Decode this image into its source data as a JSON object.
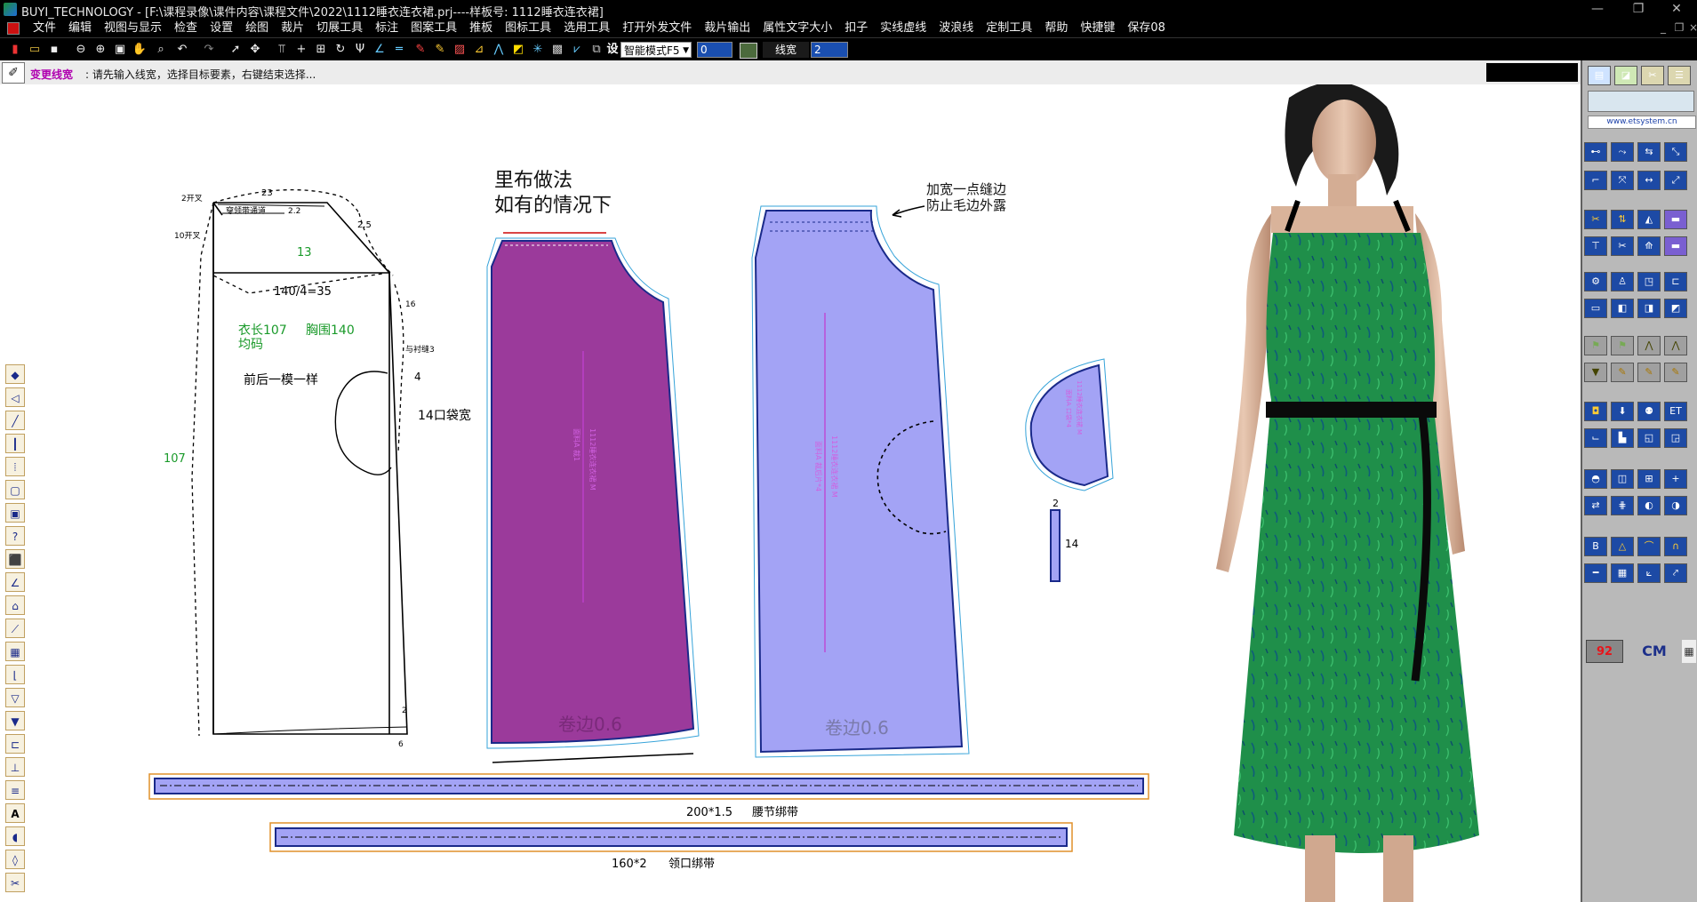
{
  "window": {
    "title": "BUYI_TECHNOLOGY - [F:\\课程录像\\课件内容\\课程文件\\2022\\1112睡衣连衣裙.prj----样板号: 1112睡衣连衣裙]"
  },
  "menu": {
    "items": [
      "文件",
      "编辑",
      "视图与显示",
      "检查",
      "设置",
      "绘图",
      "裁片",
      "切展工具",
      "标注",
      "图案工具",
      "推板",
      "图标工具",
      "选用工具",
      "打开外发文件",
      "裁片输出",
      "属性文字大小",
      "扣子",
      "实线虚线",
      "波浪线",
      "定制工具",
      "帮助",
      "快捷键",
      "保存08"
    ]
  },
  "toolbar": {
    "mode_label": "智能模式F5",
    "value_field": "0",
    "line_width_label": "线宽",
    "line_width_value": "2"
  },
  "status": {
    "command": "变更线宽",
    "prompt": ": 请先输入线宽，选择目标要素，右键结束选择..."
  },
  "pattern": {
    "left_top_2": "2开叉",
    "left_top_10": "10开叉",
    "dim_23": "23",
    "dim_22": "2.2",
    "dim_2_5": "2.5",
    "neck_tape": "穿领带通道",
    "dim_13": "13",
    "bust_calc": "140/4=35",
    "dim_16": "16",
    "size_note_1": "衣长107",
    "size_note_2": "胸围140",
    "size_note_3": "均码",
    "pocket_pos": "与衬缝3",
    "dim_4": "4",
    "pocket_width": "14口袋宽",
    "front_back": "前后一模一样",
    "length_107": "107",
    "dim_bottom_2": "2",
    "dim_bottom_6": "6",
    "lining_title_1": "里布做法",
    "lining_title_2": "如有的情况下",
    "note_widen_1": "加宽一点缝边",
    "note_widen_2": "防止毛边外露",
    "hem_1": "卷边0.6",
    "hem_2": "卷边0.6",
    "pocket_dim_2": "2",
    "pocket_dim_14": "14",
    "piece_label_1": "1112睡衣连衣裙 M",
    "piece_label_1b": "面料A 裁1",
    "piece_label_2": "1112睡衣连衣裙 M",
    "piece_label_2b": "面料A 裁后片*4",
    "piece_label_3": "1112睡衣连衣裙 M",
    "piece_label_3b": "面料A 口袋*4",
    "belt_1": "200*1.5",
    "belt_1_name": "腰节绑带",
    "belt_2": "160*2",
    "belt_2_name": "领口绑带"
  },
  "right_panel": {
    "url": "www.etsystem.cn",
    "badge": "92",
    "unit": "CM"
  },
  "colors": {
    "lining": "#9b3a9b",
    "main_piece": "#a3a3f5",
    "dress_green": "#1f8f4a",
    "accent_magenta": "#e020e0"
  }
}
